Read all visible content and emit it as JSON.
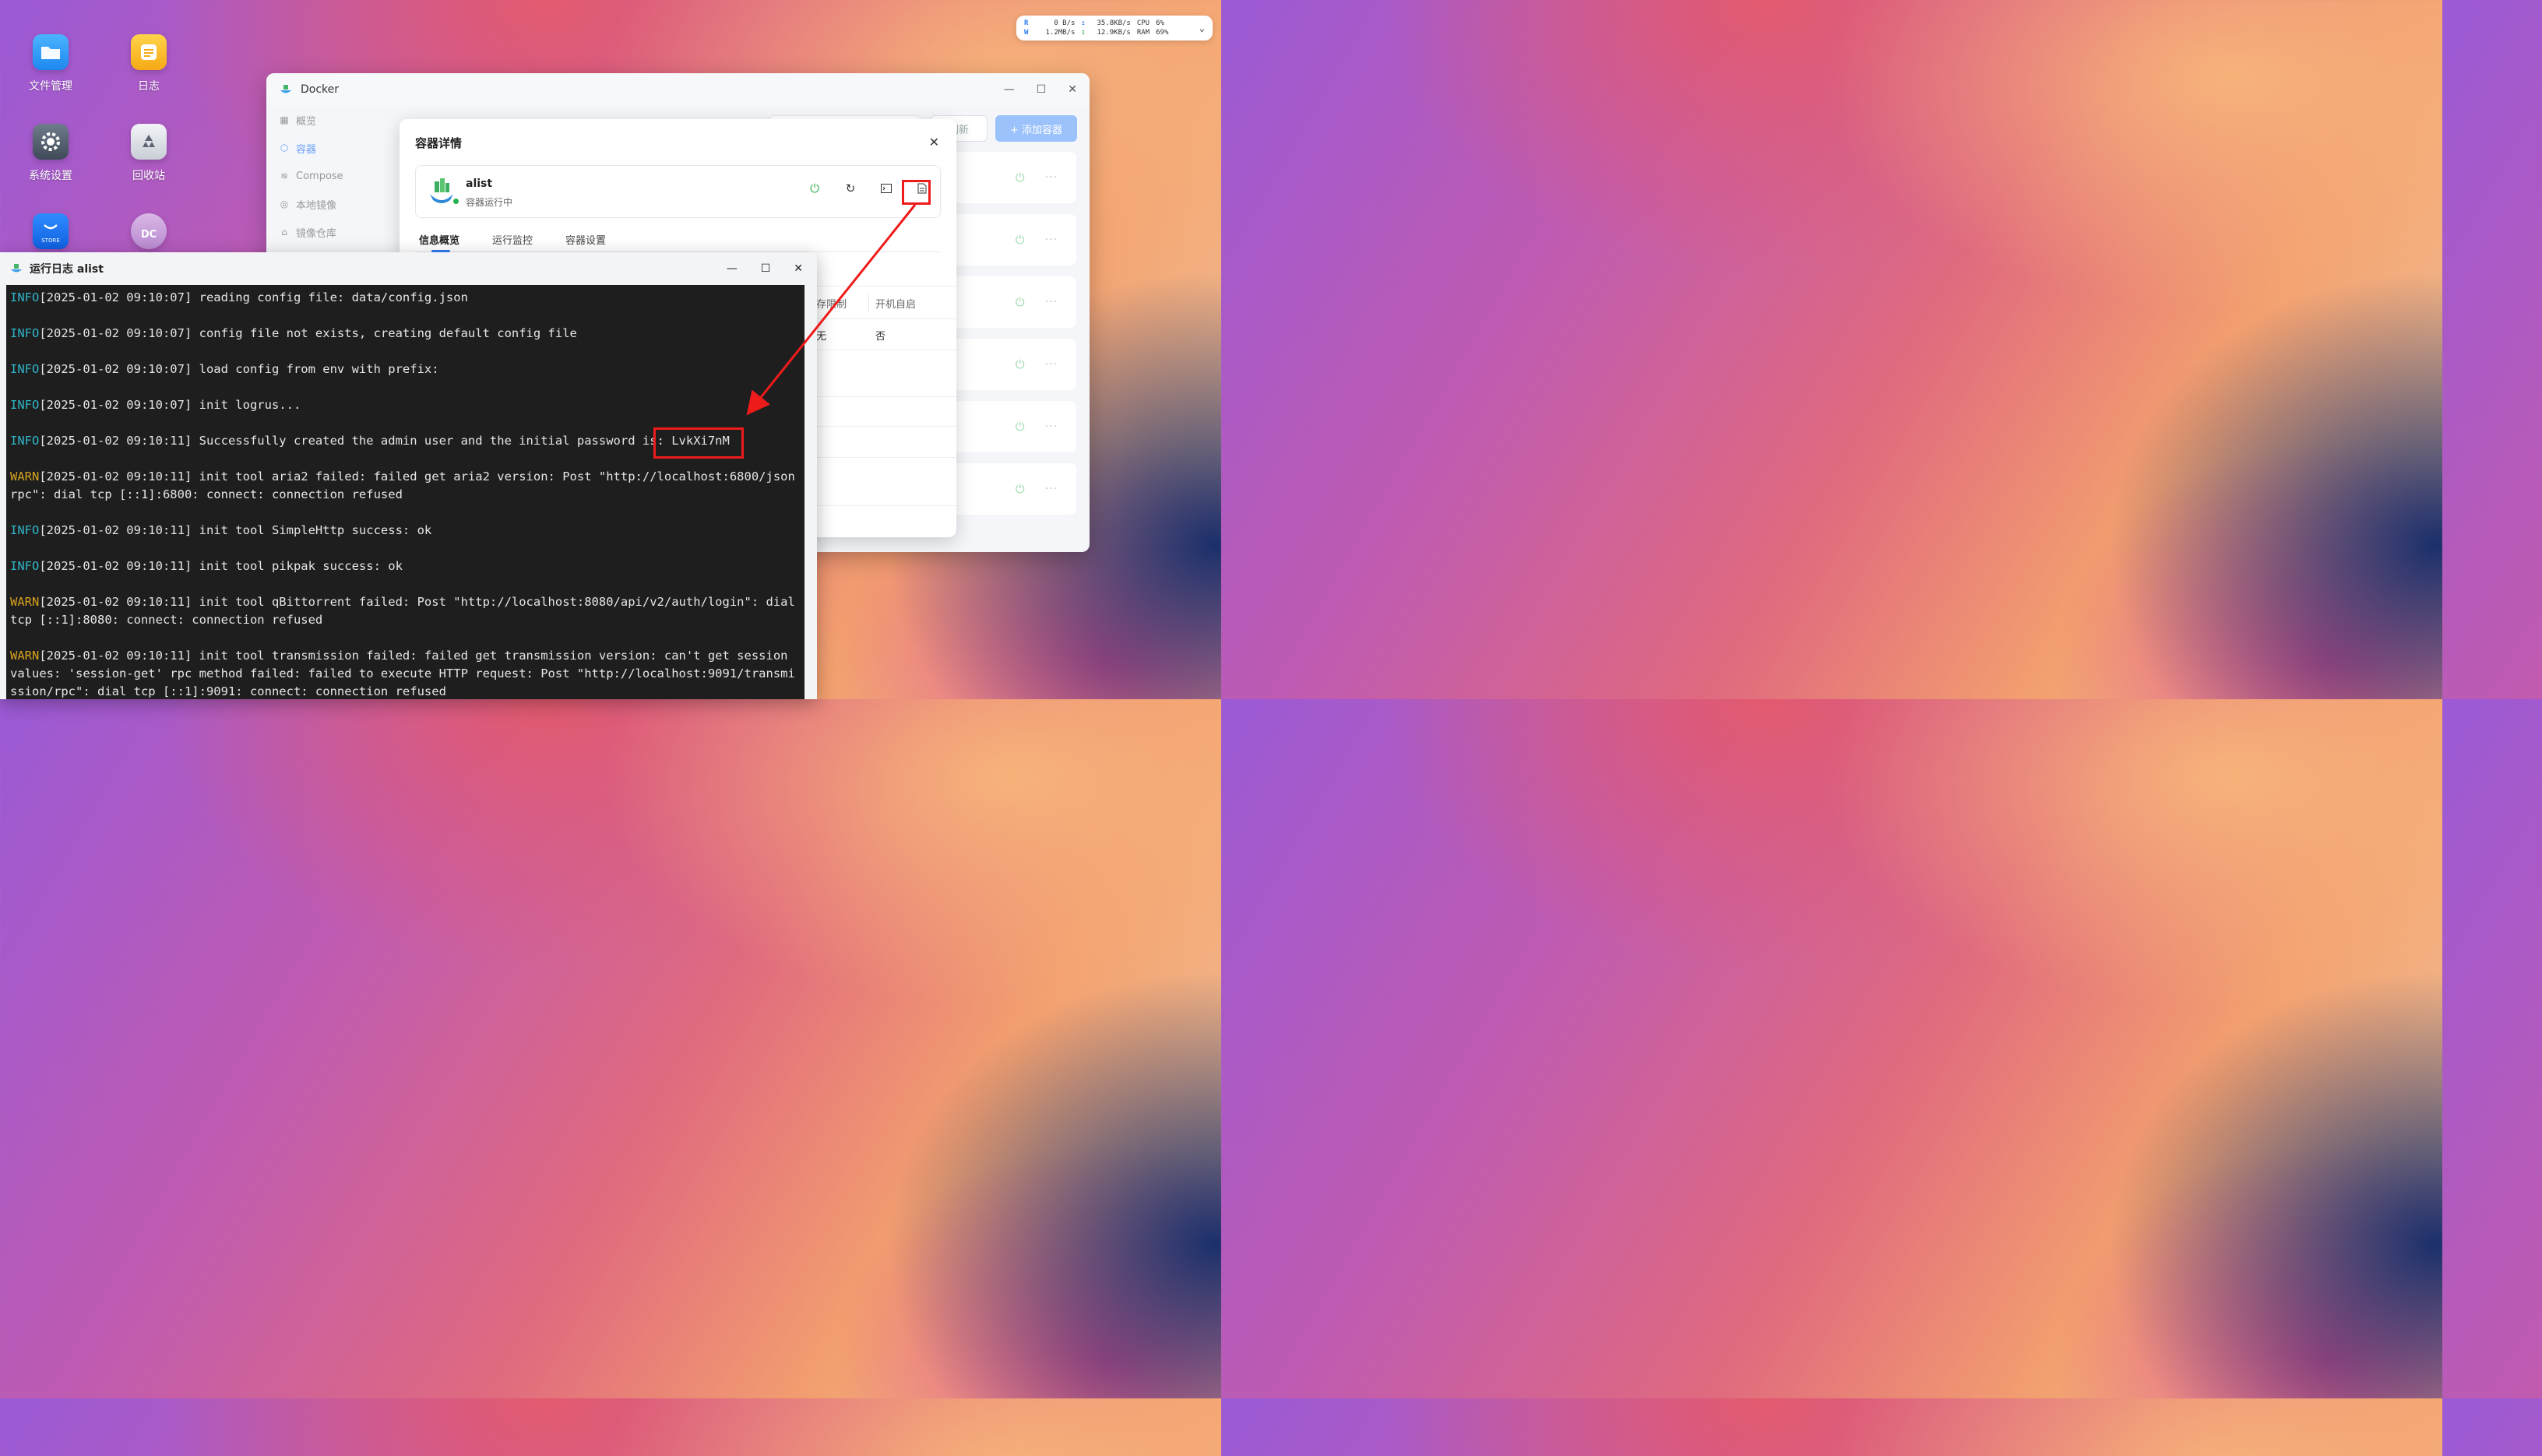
{
  "desktop": {
    "icons": [
      {
        "label": "文件管理",
        "icon": "folder-icon"
      },
      {
        "label": "日志",
        "icon": "log-icon"
      },
      {
        "label": "系统设置",
        "icon": "gear-icon"
      },
      {
        "label": "回收站",
        "icon": "recycle-icon"
      },
      {
        "label": "STORE",
        "icon": "store-icon"
      },
      {
        "label": "DC",
        "icon": "docker-dc-icon"
      }
    ]
  },
  "sysmon": {
    "r_label": "R",
    "w_label": "W",
    "r_speed": "0 B/s",
    "w_speed": "1.2MB/s",
    "up_speed": "35.8KB/s",
    "down_speed": "12.9KB/s",
    "cpu_label": "CPU",
    "ram_label": "RAM",
    "cpu_value": "6%",
    "ram_value": "69%"
  },
  "docker": {
    "title": "Docker",
    "sidebar": [
      {
        "label": "概览",
        "icon": "grid-icon"
      },
      {
        "label": "容器",
        "icon": "cube-icon"
      },
      {
        "label": "Compose",
        "icon": "layers-icon"
      },
      {
        "label": "本地镜像",
        "icon": "disc-icon"
      },
      {
        "label": "镜像仓库",
        "icon": "warehouse-icon"
      }
    ],
    "refresh_label": "刷新",
    "add_label": "+ 添加容器"
  },
  "detail": {
    "title": "容器详情",
    "container_name": "alist",
    "container_status": "容器运行中",
    "tabs": [
      "信息概览",
      "运行监控",
      "容器设置"
    ],
    "info_headers": [
      "存限制",
      "开机自启"
    ],
    "info_values": [
      "无",
      "否"
    ]
  },
  "logwin": {
    "title": "运行日志 alist",
    "lines": [
      {
        "level": "INFO",
        "text": "[2025-01-02 09:10:07] reading config file: data/config.json"
      },
      {
        "level": "INFO",
        "text": "[2025-01-02 09:10:07] config file not exists, creating default config file"
      },
      {
        "level": "INFO",
        "text": "[2025-01-02 09:10:07] load config from env with prefix:"
      },
      {
        "level": "INFO",
        "text": "[2025-01-02 09:10:07] init logrus..."
      },
      {
        "level": "INFO",
        "text": "[2025-01-02 09:10:11] Successfully created the admin user and the initial password is: LvkXi7nM"
      },
      {
        "level": "WARN",
        "text": "[2025-01-02 09:10:11] init tool aria2 failed: failed get aria2 version: Post \"http://localhost:6800/jsonrpc\": dial tcp [::1]:6800: connect: connection refused"
      },
      {
        "level": "INFO",
        "text": "[2025-01-02 09:10:11] init tool SimpleHttp success: ok"
      },
      {
        "level": "INFO",
        "text": "[2025-01-02 09:10:11] init tool pikpak success: ok"
      },
      {
        "level": "WARN",
        "text": "[2025-01-02 09:10:11] init tool qBittorrent failed: Post \"http://localhost:8080/api/v2/auth/login\": dial tcp [::1]:8080: connect: connection refused"
      },
      {
        "level": "WARN",
        "text": "[2025-01-02 09:10:11] init tool transmission failed: failed get transmission version: can't get session values: 'session-get' rpc method failed: failed to execute HTTP request: Post \"http://localhost:9091/transmission/rpc\": dial tcp [::1]:9091: connect: connection refused"
      }
    ]
  },
  "colors": {
    "accent": "#2f7cf6",
    "highlight": "#ee1b1b",
    "info": "#2fb5c9",
    "warn": "#d6a21e",
    "running": "#23b14d"
  }
}
